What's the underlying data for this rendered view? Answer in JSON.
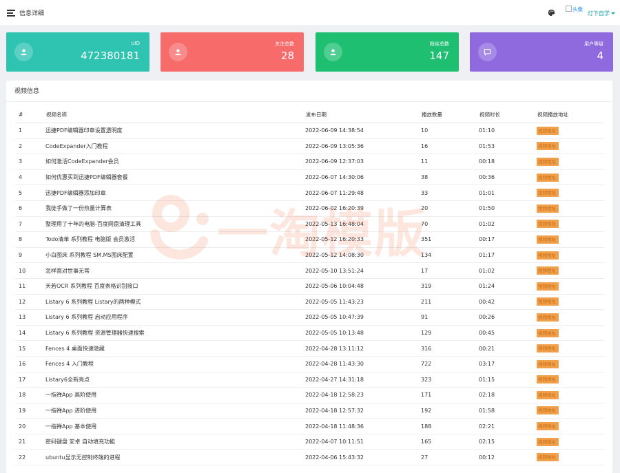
{
  "header": {
    "title": "信息详细",
    "avatar_alt": "头像",
    "user_name": "灯下自学",
    "menu_icon": "menu-fold-icon",
    "theme_icon": "palette-icon"
  },
  "stats": [
    {
      "label": "UID",
      "value": "472380181",
      "icon": "user-icon",
      "color": "#2fc3b2"
    },
    {
      "label": "关注总数",
      "value": "28",
      "icon": "user-icon",
      "color": "#f76b6b"
    },
    {
      "label": "粉丝总数",
      "value": "147",
      "icon": "user-icon",
      "color": "#1fbf72"
    },
    {
      "label": "用户等级",
      "value": "4",
      "icon": "message-icon",
      "color": "#8f6adf"
    }
  ],
  "video_panel": {
    "title": "视频信息",
    "columns": [
      "#",
      "视频名称",
      "发布日期",
      "播放数量",
      "视频时长",
      "视频播放地址"
    ],
    "link_label": "视频地址",
    "rows": [
      {
        "id": "1",
        "name": "迅捷PDF编辑器印章设置透明度",
        "date": "2022-06-09 14:38:54",
        "plays": "10",
        "duration": "01:10"
      },
      {
        "id": "2",
        "name": "CodeExpander入门教程",
        "date": "2022-06-09 13:05:36",
        "plays": "16",
        "duration": "01:53"
      },
      {
        "id": "3",
        "name": "如何激活CodeExpander会员",
        "date": "2022-06-09 12:37:03",
        "plays": "11",
        "duration": "00:18"
      },
      {
        "id": "4",
        "name": "如何优惠买到迅捷PDF编辑器套餐",
        "date": "2022-06-07 14:30:06",
        "plays": "38",
        "duration": "00:36"
      },
      {
        "id": "5",
        "name": "迅捷PDF编辑器添加印章",
        "date": "2022-06-07 11:29:48",
        "plays": "33",
        "duration": "01:01"
      },
      {
        "id": "6",
        "name": "我徒手做了一份热量计算表",
        "date": "2022-06-02 16:20:39",
        "plays": "20",
        "duration": "01:50"
      },
      {
        "id": "7",
        "name": "整理用了十年的电脑-百度网盘清理工具",
        "date": "2022-05-13 16:48:04",
        "plays": "70",
        "duration": "01:02"
      },
      {
        "id": "8",
        "name": "Todo清单 系列教程 电脑版 会员激活",
        "date": "2022-05-12 16:20:33",
        "plays": "351",
        "duration": "00:17"
      },
      {
        "id": "9",
        "name": "小白图床 系列教程 SM.MS图床配置",
        "date": "2022-05-12 14:08:30",
        "plays": "134",
        "duration": "01:17"
      },
      {
        "id": "10",
        "name": "怎样面对世事无常",
        "date": "2022-05-10 13:51:24",
        "plays": "17",
        "duration": "01:02"
      },
      {
        "id": "11",
        "name": "天若OCR 系列教程 百度表格识别接口",
        "date": "2022-05-06 10:04:48",
        "plays": "319",
        "duration": "01:24"
      },
      {
        "id": "12",
        "name": "Listary 6 系列教程 Listary的两种模式",
        "date": "2022-05-05 11:43:23",
        "plays": "211",
        "duration": "00:42"
      },
      {
        "id": "13",
        "name": "Listary 6 系列教程 启动应用程序",
        "date": "2022-05-05 10:47:39",
        "plays": "91",
        "duration": "00:26"
      },
      {
        "id": "14",
        "name": "Listary 6 系列教程 资源管理器快速搜索",
        "date": "2022-05-05 10:13:48",
        "plays": "129",
        "duration": "00:45"
      },
      {
        "id": "15",
        "name": "Fences 4 桌面快速隐藏",
        "date": "2022-04-28 13:11:12",
        "plays": "316",
        "duration": "00:21"
      },
      {
        "id": "16",
        "name": "Fences 4 入门教程",
        "date": "2022-04-28 11:43:30",
        "plays": "722",
        "duration": "03:17"
      },
      {
        "id": "17",
        "name": "Listary6全新亮点",
        "date": "2022-04-27 14:31:18",
        "plays": "323",
        "duration": "01:15"
      },
      {
        "id": "18",
        "name": "一指禅App 高阶使用",
        "date": "2022-04-18 12:58:23",
        "plays": "171",
        "duration": "02:18"
      },
      {
        "id": "19",
        "name": "一指禅App 进阶使用",
        "date": "2022-04-18 12:57:32",
        "plays": "192",
        "duration": "01:58"
      },
      {
        "id": "20",
        "name": "一指禅App 基本使用",
        "date": "2022-04-18 11:48:36",
        "plays": "188",
        "duration": "02:21"
      },
      {
        "id": "21",
        "name": "密码键盘 安卓 自动填充功能",
        "date": "2022-04-07 10:11:51",
        "plays": "165",
        "duration": "02:15"
      },
      {
        "id": "22",
        "name": "ubuntu显示无控制终端的进程",
        "date": "2022-04-06 15:43:32",
        "plays": "27",
        "duration": "00:12"
      }
    ]
  },
  "watermark": {
    "text": "一淘模版"
  },
  "colors": {
    "accent": "#1aa6a6",
    "link_button": "#f0a04b"
  }
}
